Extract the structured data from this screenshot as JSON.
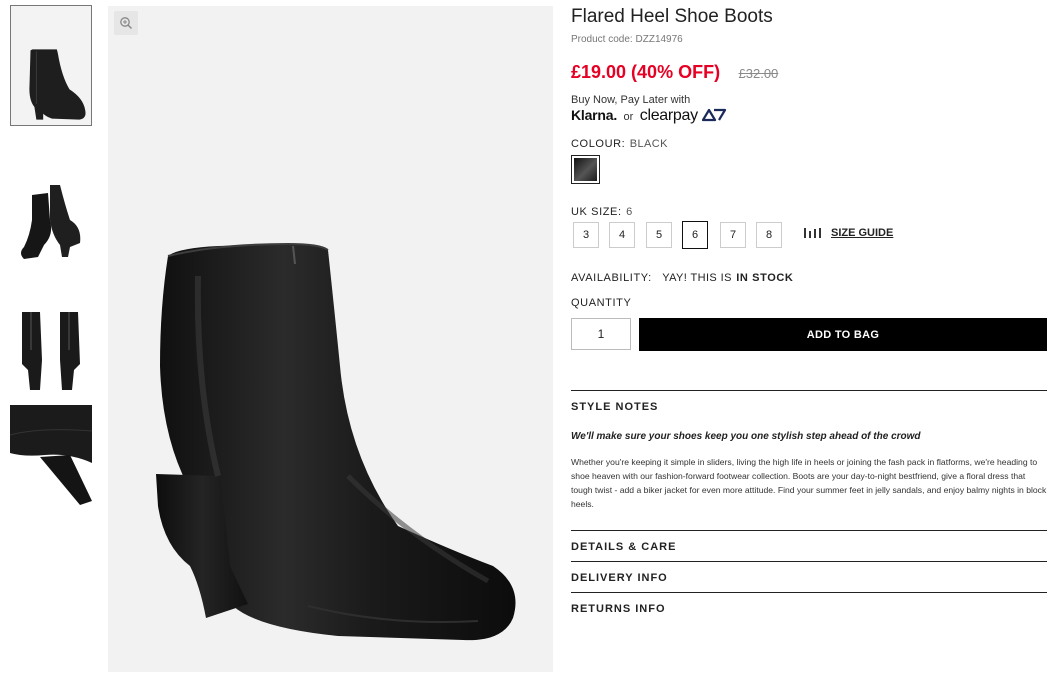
{
  "product": {
    "title": "Flared Heel Shoe Boots",
    "code_label": "Product code:",
    "code": "DZZ14976"
  },
  "price": {
    "now": "£19.00 (40% OFF)",
    "was": "£32.00",
    "sale_color": "#e60023"
  },
  "payment": {
    "label": "Buy Now, Pay Later with",
    "klarna": "Klarna.",
    "or": "or",
    "clearpay": "clearpay"
  },
  "colour": {
    "label": "COLOUR:",
    "value": "BLACK",
    "swatch": "#111111"
  },
  "size": {
    "label": "UK SIZE:",
    "value": "6",
    "options": [
      "3",
      "4",
      "5",
      "6",
      "7",
      "8"
    ],
    "selected": "6",
    "guide_label": "SIZE GUIDE",
    "guide_icon": "size-guide-icon"
  },
  "availability": {
    "label": "AVAILABILITY:",
    "text": "YAY! THIS IS",
    "status": "IN STOCK"
  },
  "quantity": {
    "label": "QUANTITY",
    "value": "1"
  },
  "add_to_bag": "ADD TO BAG",
  "style_notes": {
    "title": "STYLE NOTES",
    "tagline": "We'll make sure your shoes keep you one stylish step ahead of the crowd",
    "description": "Whether you're keeping it simple in sliders, living the high life in heels or joining the fash pack in flatforms, we're heading to shoe heaven with our fashion-forward footwear collection. Boots are your day-to-night bestfriend, give a floral dress that tough twist - add a biker jacket for even more attitude. Find your summer feet in jelly sandals, and enjoy balmy nights in block heels."
  },
  "accordions": [
    "DETAILS & CARE",
    "DELIVERY INFO",
    "RETURNS INFO"
  ],
  "gallery": {
    "zoom_icon": "zoom-in-icon",
    "thumbnails": [
      "boot-side-view",
      "boot-pair-angled",
      "boot-pair-back",
      "heel-close-up"
    ]
  }
}
